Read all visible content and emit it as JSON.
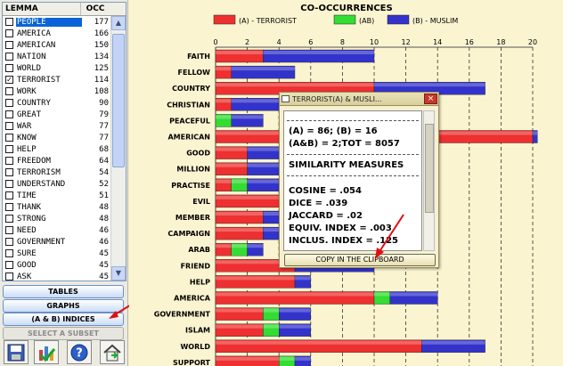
{
  "lemma_table": {
    "headers": {
      "lemma": "LEMMA",
      "occ": "OCC"
    },
    "rows": [
      {
        "word": "PEOPLE",
        "occ": "177",
        "checked": false,
        "selected": true
      },
      {
        "word": "AMERICA",
        "occ": "166",
        "checked": false
      },
      {
        "word": "AMERICAN",
        "occ": "150",
        "checked": false
      },
      {
        "word": "NATION",
        "occ": "134",
        "checked": false
      },
      {
        "word": "WORLD",
        "occ": "125",
        "checked": false
      },
      {
        "word": "TERRORIST",
        "occ": "114",
        "checked": true
      },
      {
        "word": "WORK",
        "occ": "108",
        "checked": false
      },
      {
        "word": "COUNTRY",
        "occ": "90",
        "checked": false
      },
      {
        "word": "GREAT",
        "occ": "79",
        "checked": false
      },
      {
        "word": "WAR",
        "occ": "77",
        "checked": false
      },
      {
        "word": "KNOW",
        "occ": "77",
        "checked": false
      },
      {
        "word": "HELP",
        "occ": "68",
        "checked": false
      },
      {
        "word": "FREEDOM",
        "occ": "64",
        "checked": false
      },
      {
        "word": "TERRORISM",
        "occ": "54",
        "checked": false
      },
      {
        "word": "UNDERSTAND",
        "occ": "52",
        "checked": false
      },
      {
        "word": "TIME",
        "occ": "51",
        "checked": false
      },
      {
        "word": "THANK",
        "occ": "48",
        "checked": false
      },
      {
        "word": "STRONG",
        "occ": "48",
        "checked": false
      },
      {
        "word": "NEED",
        "occ": "46",
        "checked": false
      },
      {
        "word": "GOVERNMENT",
        "occ": "46",
        "checked": false
      },
      {
        "word": "SURE",
        "occ": "45",
        "checked": false
      },
      {
        "word": "GOOD",
        "occ": "45",
        "checked": false
      },
      {
        "word": "ASK",
        "occ": "45",
        "checked": false
      }
    ]
  },
  "buttons": {
    "tables": "TABLES",
    "graphs": "GRAPHS",
    "indices": "(A & B)  INDICES",
    "subset": "SELECT A SUBSET"
  },
  "icons": [
    "save-icon",
    "check-chart-icon",
    "help-icon",
    "home-icon"
  ],
  "chart_data": {
    "type": "bar",
    "title": "CO-OCCURRENCES",
    "legend": [
      {
        "name": "(A) - TERRORIST",
        "color": "#ee3030"
      },
      {
        "name": "(AB)",
        "color": "#33dd33"
      },
      {
        "name": "(B) - MUSLIM",
        "color": "#3333cc"
      }
    ],
    "legend_position": "top",
    "orientation": "horizontal",
    "stacked": true,
    "xlim": [
      0,
      20
    ],
    "xticks": [
      0,
      2,
      4,
      6,
      8,
      10,
      12,
      14,
      16,
      18,
      20
    ],
    "grid": true,
    "categories": [
      "FAITH",
      "FELLOW",
      "COUNTRY",
      "CHRISTIAN",
      "PEACEFUL",
      "AMERICAN",
      "GOOD",
      "MILLION",
      "PRACTISE",
      "EVIL",
      "MEMBER",
      "CAMPAIGN",
      "ARAB",
      "FRIEND",
      "HELP",
      "AMERICA",
      "GOVERNMENT",
      "ISLAM",
      "WORLD",
      "SUPPORT"
    ],
    "series": [
      {
        "name": "(A) - TERRORIST",
        "values": [
          3,
          1,
          10,
          1,
          0,
          20,
          2,
          2,
          1,
          6,
          3,
          3,
          1,
          5,
          5,
          10,
          3,
          3,
          13,
          4
        ]
      },
      {
        "name": "(AB)",
        "values": [
          0,
          0,
          0,
          0,
          1,
          0,
          0,
          0,
          1,
          0,
          0,
          0,
          1,
          0,
          0,
          1,
          1,
          1,
          0,
          1
        ]
      },
      {
        "name": "(B) - MUSLIM",
        "values": [
          7,
          4,
          7,
          5,
          2,
          0.3,
          4,
          4,
          4,
          1,
          4,
          3,
          1,
          5,
          1,
          3,
          2,
          2,
          4,
          1
        ]
      }
    ],
    "colors": {
      "a": "#ee3030",
      "ab": "#33dd33",
      "b": "#3333cc"
    }
  },
  "popup": {
    "title": "TERRORIST(A) & MUSLI...",
    "close_label": "×",
    "line1": "(A) =  86; (B) =  16",
    "line2": "(A&B) =  2;TOT = 8057",
    "section": "SIMILARITY MEASURES",
    "cosine": "COSINE =  .054",
    "dice": "DICE =  .039",
    "jaccard": "JACCARD =  .02",
    "equiv": "EQUIV. INDEX =  .003",
    "inclus": "INCLUS. INDEX =  .125",
    "copy_button": "COPY IN THE CLIPBOARD"
  }
}
